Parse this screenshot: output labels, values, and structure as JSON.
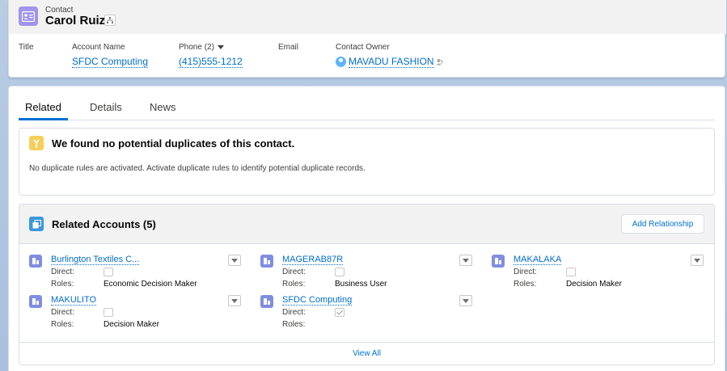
{
  "header": {
    "object_label": "Contact",
    "record_name": "Carol Ruiz",
    "fields": {
      "title": {
        "label": "Title",
        "value": ""
      },
      "account_name": {
        "label": "Account Name",
        "value": "SFDC Computing"
      },
      "phone": {
        "label": "Phone (2)",
        "value": "(415)555-1212"
      },
      "email": {
        "label": "Email",
        "value": ""
      },
      "owner": {
        "label": "Contact Owner",
        "value": "MAVADU FASHION"
      }
    }
  },
  "tabs": [
    {
      "label": "Related",
      "active": true
    },
    {
      "label": "Details",
      "active": false
    },
    {
      "label": "News",
      "active": false
    }
  ],
  "duplicates": {
    "title": "We found no potential duplicates of this contact.",
    "body": "No duplicate rules are activated. Activate duplicate rules to identify potential duplicate records."
  },
  "related_accounts": {
    "title": "Related Accounts (5)",
    "add_button": "Add Relationship",
    "direct_label": "Direct:",
    "roles_label": "Roles:",
    "items": [
      {
        "name": "Burlington Textiles C...",
        "direct": false,
        "roles": "Economic Decision Maker"
      },
      {
        "name": "MAGERAB87R",
        "direct": false,
        "roles": "Business User"
      },
      {
        "name": "MAKALAKA",
        "direct": false,
        "roles": "Decision Maker"
      },
      {
        "name": "MAKULITO",
        "direct": false,
        "roles": "Decision Maker"
      },
      {
        "name": "SFDC Computing",
        "direct": true,
        "roles": ""
      }
    ],
    "view_all": "View All"
  },
  "colors": {
    "brand": "#0070d2",
    "link": "#006dcc",
    "contact_icon": "#a094ed",
    "account_icon": "#7f8de1",
    "related_icon": "#3c97dd",
    "duplicate_icon": "#f4d05b"
  },
  "icons": {
    "contact": "contact-card-icon",
    "hierarchy": "hierarchy-icon",
    "owner": "user-avatar-icon",
    "change_owner": "change-owner-icon",
    "duplicate": "merge-icon",
    "related": "account-relationship-icon",
    "account": "account-icon",
    "menu": "chevron-down-icon"
  }
}
